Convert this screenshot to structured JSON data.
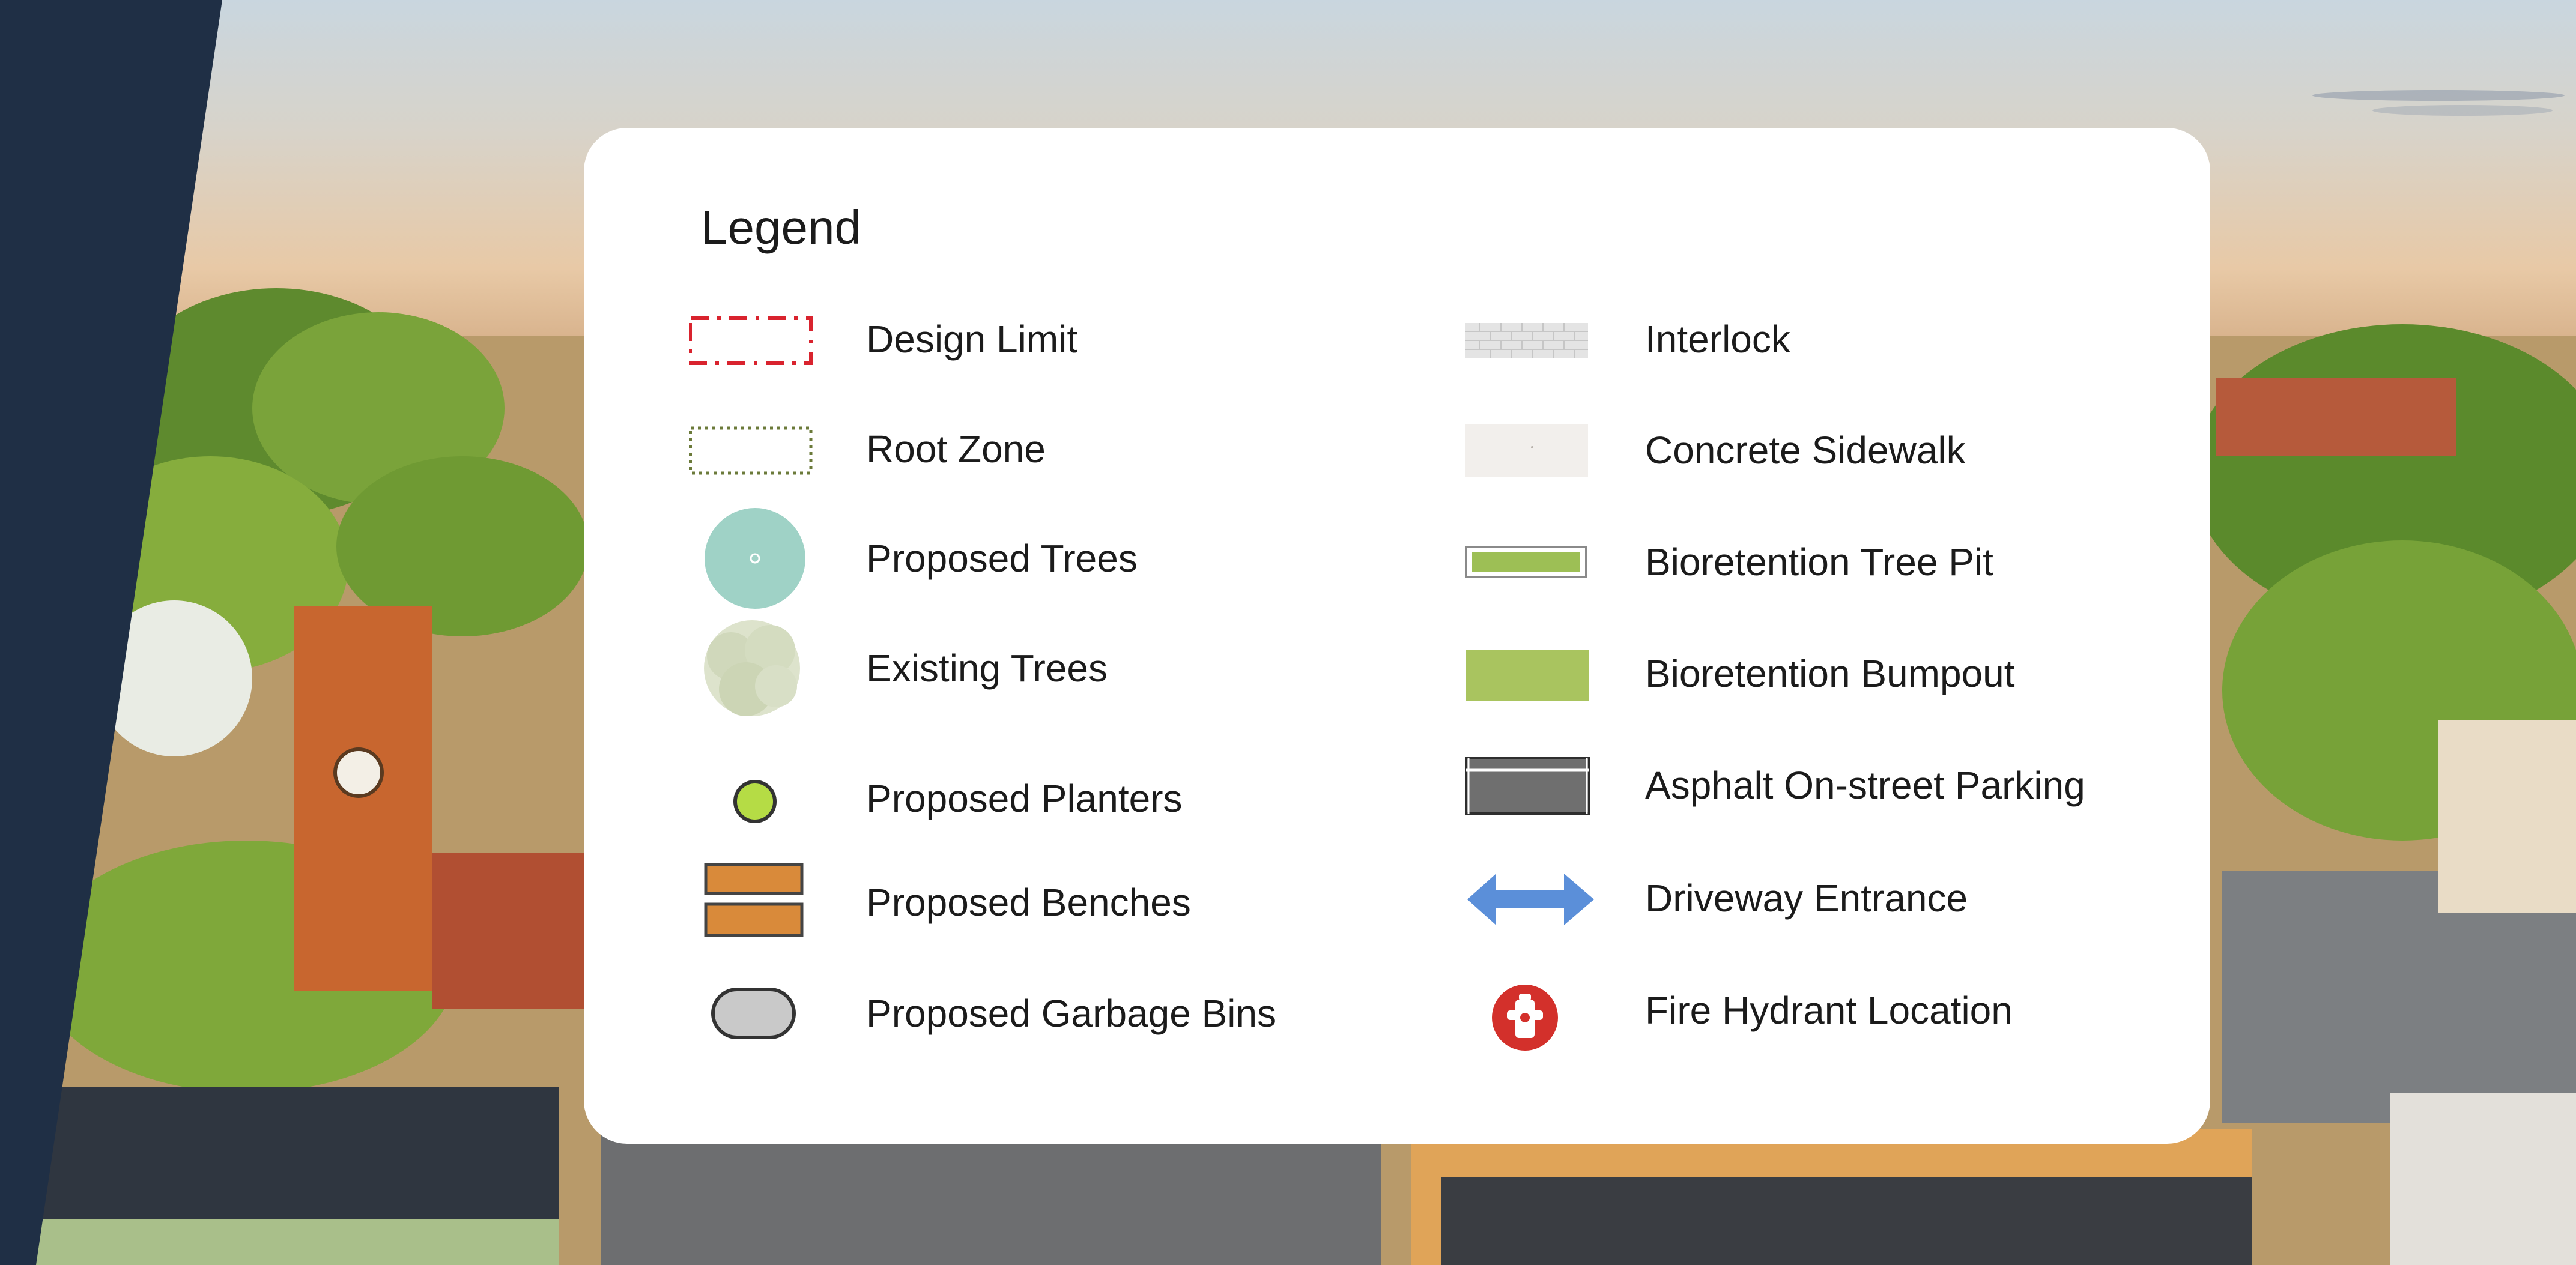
{
  "legend": {
    "title": "Legend",
    "left_items": [
      {
        "label": "Design Limit",
        "icon": "design-limit-icon"
      },
      {
        "label": "Root Zone",
        "icon": "root-zone-icon"
      },
      {
        "label": "Proposed Trees",
        "icon": "proposed-tree-icon"
      },
      {
        "label": "Existing Trees",
        "icon": "existing-tree-icon"
      },
      {
        "label": "Proposed Planters",
        "icon": "planter-icon"
      },
      {
        "label": "Proposed Benches",
        "icon": "bench-icon"
      },
      {
        "label": "Proposed Garbage Bins",
        "icon": "garbage-bin-icon"
      }
    ],
    "right_items": [
      {
        "label": "Interlock",
        "icon": "interlock-icon"
      },
      {
        "label": "Concrete Sidewalk",
        "icon": "concrete-sidewalk-icon"
      },
      {
        "label": "Bioretention Tree Pit",
        "icon": "bioretention-tree-pit-icon"
      },
      {
        "label": "Bioretention Bumpout",
        "icon": "bioretention-bumpout-icon"
      },
      {
        "label": "Asphalt On-street Parking",
        "icon": "asphalt-parking-icon"
      },
      {
        "label": "Driveway Entrance",
        "icon": "driveway-arrow-icon"
      },
      {
        "label": "Fire Hydrant Location",
        "icon": "fire-hydrant-icon"
      }
    ]
  },
  "colors": {
    "navy_band": "#1f2f45",
    "design_limit": "#d9232e",
    "root_zone": "#6b7a3a",
    "proposed_tree": "#9fd2c6",
    "planter": "#b5dc45",
    "bench": "#d98a3a",
    "bioretention": "#9dbf55",
    "driveway_arrow": "#5b8fd9",
    "hydrant": "#d3302b"
  }
}
